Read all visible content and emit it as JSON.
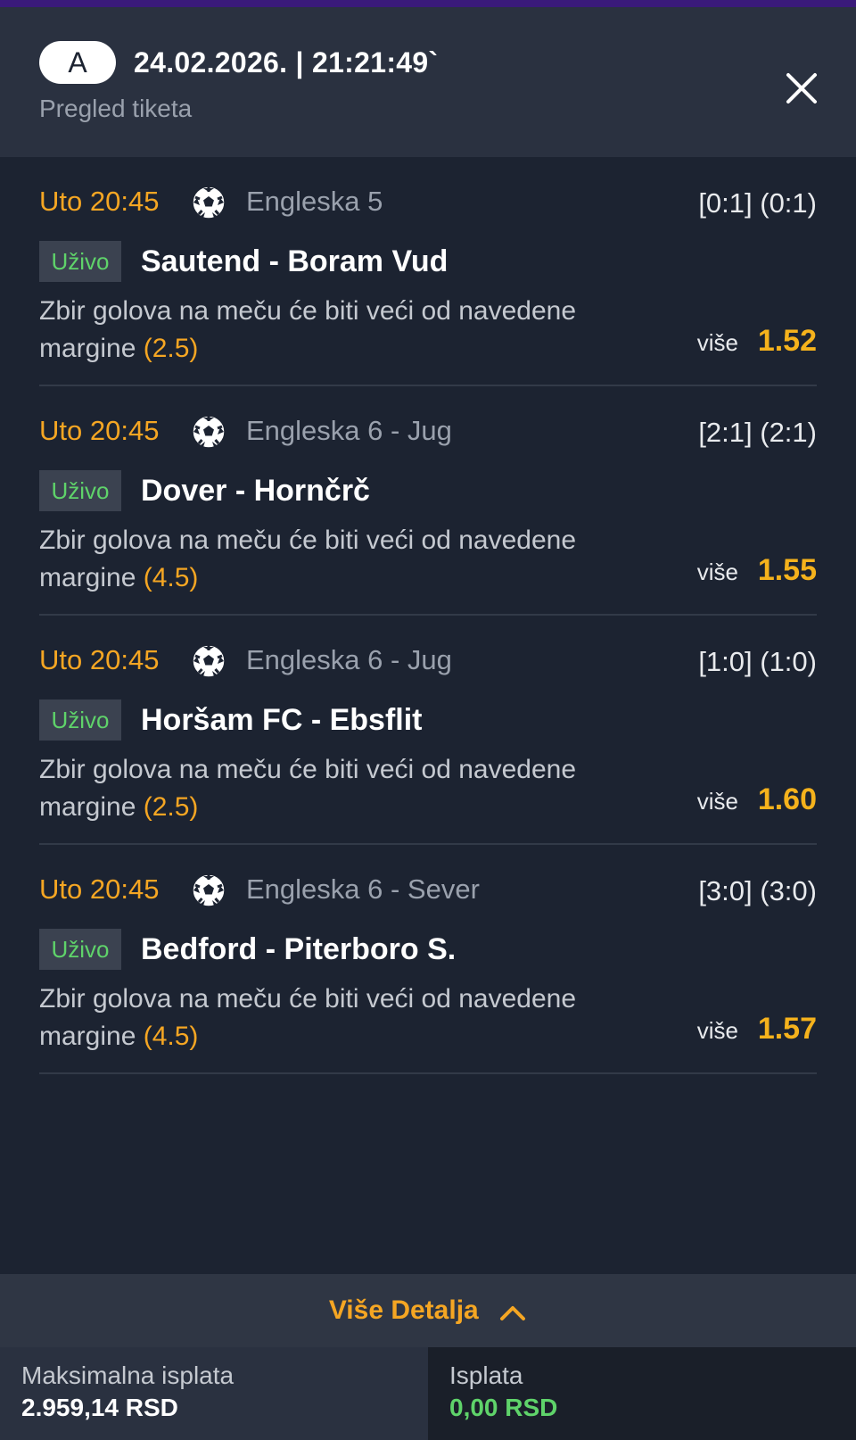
{
  "header": {
    "badge": "A",
    "datetime": "24.02.2026. | 21:21:49`",
    "subtitle": "Pregled tiketa",
    "close_icon": "close-icon"
  },
  "matches": [
    {
      "time": "Uto 20:45",
      "sport_icon": "soccer-ball-icon",
      "league": "Engleska 5",
      "score": "[0:1] (0:1)",
      "live": "Uživo",
      "teams": "Sautend - Boram Vud",
      "market": "Zbir golova na meču će biti veći od navedene margine",
      "margin": "(2.5)",
      "pick": "više",
      "odds": "1.52"
    },
    {
      "time": "Uto 20:45",
      "sport_icon": "soccer-ball-icon",
      "league": "Engleska 6 - Jug",
      "score": "[2:1] (2:1)",
      "live": "Uživo",
      "teams": "Dover - Hornčrč",
      "market": "Zbir golova na meču će biti veći od navedene margine",
      "margin": "(4.5)",
      "pick": "više",
      "odds": "1.55"
    },
    {
      "time": "Uto 20:45",
      "sport_icon": "soccer-ball-icon",
      "league": "Engleska 6 - Jug",
      "score": "[1:0] (1:0)",
      "live": "Uživo",
      "teams": "Horšam FC - Ebsflit",
      "market": "Zbir golova na meču će biti veći od navedene margine",
      "margin": "(2.5)",
      "pick": "više",
      "odds": "1.60"
    },
    {
      "time": "Uto 20:45",
      "sport_icon": "soccer-ball-icon",
      "league": "Engleska 6 - Sever",
      "score": "[3:0] (3:0)",
      "live": "Uživo",
      "teams": "Bedford - Piterboro S.",
      "market": "Zbir golova na meču će biti veći od navedene margine",
      "margin": "(4.5)",
      "pick": "više",
      "odds": "1.57"
    }
  ],
  "details": {
    "label": "Više Detalja",
    "icon": "chevron-up-icon"
  },
  "footer": {
    "max_payout_label": "Maksimalna isplata",
    "max_payout_value": "2.959,14 RSD",
    "payout_label": "Isplata",
    "payout_value": "0,00 RSD"
  },
  "colors": {
    "accent": "#f5a623",
    "live_green": "#5fd36a",
    "background": "#1c2331",
    "header_bg": "#2a3140"
  }
}
